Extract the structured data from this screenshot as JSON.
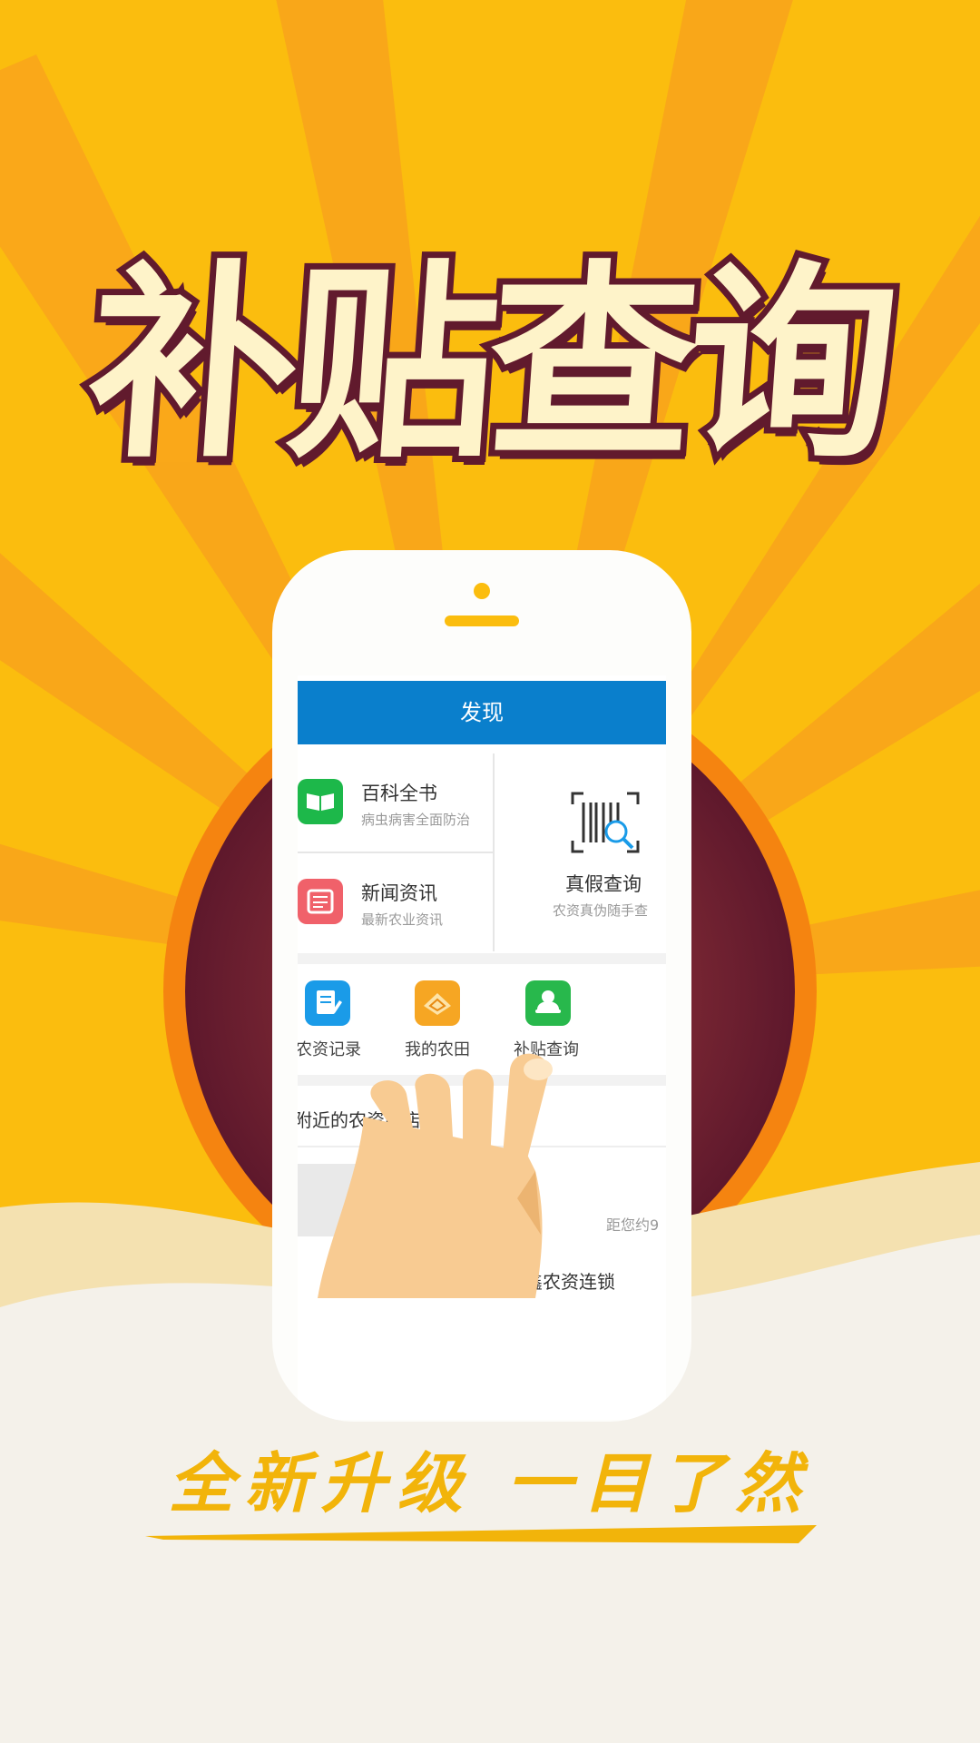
{
  "headline": "补贴查询",
  "app": {
    "title": "发现",
    "tiles": [
      {
        "title": "百科全书",
        "subtitle": "病虫病害全面防治",
        "icon": "book-icon",
        "color": "#1db84a"
      },
      {
        "title": "新闻资讯",
        "subtitle": "最新农业资讯",
        "icon": "newspaper-icon",
        "color": "#f0616a"
      },
      {
        "title": "真假查询",
        "subtitle": "农资真伪随手查",
        "icon": "barcode-scan-icon"
      }
    ],
    "shortcuts": [
      {
        "label": "农资记录",
        "icon": "note-edit-icon",
        "color": "#1a9be8"
      },
      {
        "label": "我的农田",
        "icon": "farmland-icon",
        "color": "#f6a623"
      },
      {
        "label": "补贴查询",
        "icon": "subsidy-icon",
        "color": "#28b84c"
      }
    ],
    "nearby_title": "附近的农资门店",
    "distance_text": "距您约9",
    "store_name_partial": "鑫农资连锁"
  },
  "slogan": "全新升级  一目了然",
  "colors": {
    "background": "#fbbd0e",
    "ring": "#f58410",
    "disk": "#6b1d31",
    "bar": "#0a7fcc"
  }
}
